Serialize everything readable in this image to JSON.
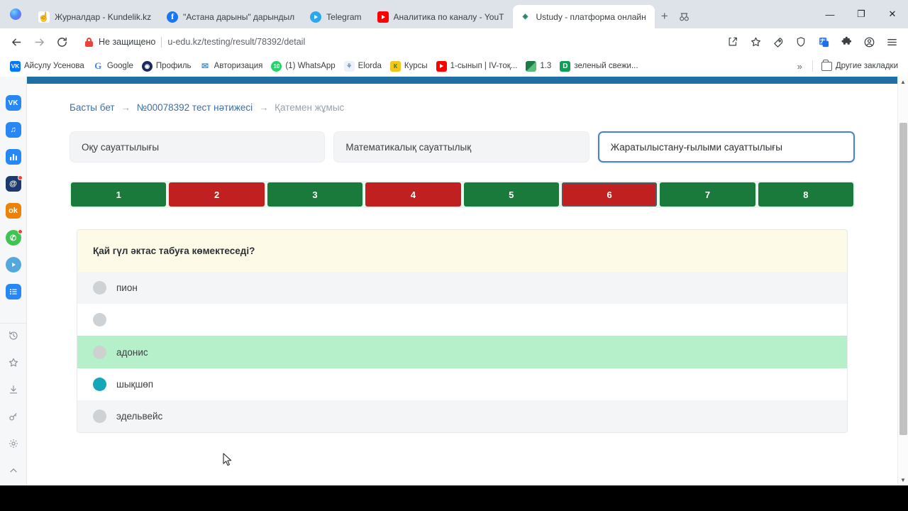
{
  "browser": {
    "tabs": [
      {
        "title": "Журналдар - Kundelik.kz",
        "icon": "kundelik-favicon",
        "active": false
      },
      {
        "title": "\"Астана дарыны\" дарындыл",
        "icon": "facebook-favicon",
        "active": false
      },
      {
        "title": "Telegram",
        "icon": "telegram-favicon",
        "active": false
      },
      {
        "title": "Аналитика по каналу - YouT",
        "icon": "youtube-favicon",
        "active": false
      },
      {
        "title": "Ustudy - платформа онлайн",
        "icon": "ustudy-favicon",
        "active": true
      }
    ],
    "new_tab_label": "+",
    "tab_search_icon": "tab-search-icon",
    "window_controls": {
      "minimize": "—",
      "maximize": "❐",
      "close": "✕"
    },
    "nav": {
      "back": "←",
      "forward": "→",
      "reload": "⟳"
    },
    "omnibox": {
      "security_label": "Не защищено",
      "url": "u-edu.kz/testing/result/78392/detail",
      "lock_icon": "insecure-lock-icon"
    },
    "toolbar_icons": [
      "share-icon",
      "bookmark-star-icon",
      "rocket-icon",
      "shield-icon",
      "translate-icon",
      "extensions-puzzle-icon",
      "profile-avatar-icon",
      "browser-menu-icon"
    ],
    "bookmarks": [
      {
        "label": "Айсулу Усенова",
        "icon": "vk-icon",
        "glyph": "VK"
      },
      {
        "label": "Google",
        "icon": "google-icon",
        "glyph": "G"
      },
      {
        "label": "Профиль",
        "icon": "profile-icon",
        "glyph": "◉"
      },
      {
        "label": "Авторизация",
        "icon": "auth-icon",
        "glyph": "✉"
      },
      {
        "label": "(1) WhatsApp",
        "icon": "whatsapp-icon",
        "glyph": "10"
      },
      {
        "label": "Elorda",
        "icon": "elorda-icon",
        "glyph": "Ε"
      },
      {
        "label": "Курсы",
        "icon": "kursy-icon",
        "glyph": "К"
      },
      {
        "label": "1-сынып | IV-тоқ...",
        "icon": "youtube-icon",
        "glyph": "▶"
      },
      {
        "label": "1.3",
        "icon": "sheets-icon",
        "glyph": ""
      },
      {
        "label": "зеленый свежи...",
        "icon": "docs-icon",
        "glyph": "D"
      }
    ],
    "bookmarks_overflow": "»",
    "other_bookmarks": "Другие закладки"
  },
  "rail": {
    "items": [
      {
        "name": "vk-icon",
        "glyph": "VK",
        "badge": false
      },
      {
        "name": "vk-music-icon",
        "glyph": "♫",
        "badge": false
      },
      {
        "name": "vk-stats-icon",
        "glyph": "▮▮",
        "badge": false
      },
      {
        "name": "mail-icon",
        "glyph": "@",
        "badge": true
      },
      {
        "name": "odnoklassniki-icon",
        "glyph": "ok",
        "badge": false
      },
      {
        "name": "whatsapp-icon",
        "glyph": "✆",
        "badge": true
      },
      {
        "name": "telegram-icon",
        "glyph": "➤",
        "badge": false
      },
      {
        "name": "list-icon",
        "glyph": "≔",
        "badge": false
      }
    ],
    "tools": [
      {
        "name": "history-icon",
        "glyph": "↺"
      },
      {
        "name": "favorites-star-icon",
        "glyph": "☆"
      },
      {
        "name": "download-icon",
        "glyph": "⤓"
      },
      {
        "name": "password-key-icon",
        "glyph": "🗝"
      },
      {
        "name": "settings-gear-icon",
        "glyph": "⚙"
      },
      {
        "name": "collapse-chevron-up-icon",
        "glyph": "⌃"
      }
    ]
  },
  "page": {
    "breadcrumb": {
      "home": "Басты бет",
      "result": "№00078392 тест нәтижесі",
      "current": "Қатемен жұмыс",
      "separator": "→"
    },
    "subjects": [
      {
        "label": "Оқу сауаттылығы",
        "active": false
      },
      {
        "label": "Математикалық сауаттылық",
        "active": false
      },
      {
        "label": "Жаратылыстану-ғылыми сауаттылығы",
        "active": true
      }
    ],
    "question_nav": [
      {
        "number": "1",
        "status": "correct",
        "current": false
      },
      {
        "number": "2",
        "status": "wrong",
        "current": false
      },
      {
        "number": "3",
        "status": "correct",
        "current": false
      },
      {
        "number": "4",
        "status": "wrong",
        "current": false
      },
      {
        "number": "5",
        "status": "correct",
        "current": false
      },
      {
        "number": "6",
        "status": "wrong",
        "current": true
      },
      {
        "number": "7",
        "status": "correct",
        "current": false
      },
      {
        "number": "8",
        "status": "correct",
        "current": false
      }
    ],
    "question": {
      "text": "Қай гүл әктас табуға көмектеседі?",
      "options": [
        {
          "label": "пион",
          "state": "shade",
          "selected": false
        },
        {
          "label": "",
          "state": "plain",
          "selected": false
        },
        {
          "label": "адонис",
          "state": "correct",
          "selected": false
        },
        {
          "label": "шықшөп",
          "state": "plain",
          "selected": true
        },
        {
          "label": "эдельвейс",
          "state": "shade",
          "selected": false
        }
      ]
    }
  },
  "colors": {
    "correct_green": "#1a7a3c",
    "wrong_red": "#c0201f",
    "correct_option_bg": "#b5f0ca",
    "selected_radio": "#15a6b8",
    "active_tab_border": "#4a7fd4",
    "breadcrumb_link": "#3f6ea8",
    "page_topbar": "#1f6fa5"
  }
}
